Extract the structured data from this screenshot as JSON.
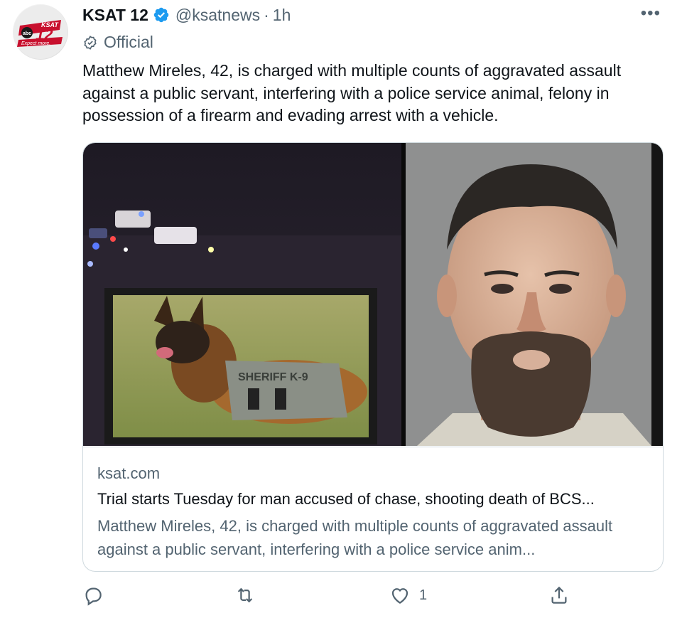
{
  "account": {
    "name": "KSAT 12",
    "handle": "@ksatnews",
    "separator": "·",
    "time": "1h",
    "label": "Official",
    "avatar_logo_text": [
      "KSAT",
      "abc",
      "12",
      "Expect more."
    ]
  },
  "tweet": {
    "text": "Matthew Mireles, 42, is charged with multiple counts of aggravated assault against a public servant, interfering with a police service animal, felony in possession of a firearm and evading arrest with a vehicle."
  },
  "card": {
    "domain": "ksat.com",
    "title": "Trial starts Tuesday for man accused of chase, shooting death of BCS...",
    "description": "Matthew Mireles, 42, is charged with multiple counts of aggravated assault against a public servant, interfering with a police service anim...",
    "vest_text": "SHERIFF K-9"
  },
  "actions": {
    "reply": {
      "icon": "reply-icon",
      "count": ""
    },
    "retweet": {
      "icon": "retweet-icon",
      "count": ""
    },
    "like": {
      "icon": "heart-icon",
      "count": "1"
    },
    "share": {
      "icon": "share-icon",
      "count": ""
    }
  },
  "colors": {
    "text": "#0f1419",
    "secondary": "#536471",
    "verified": "#1d9bf0",
    "border": "#cfd9de",
    "brand_red": "#c8102e"
  }
}
